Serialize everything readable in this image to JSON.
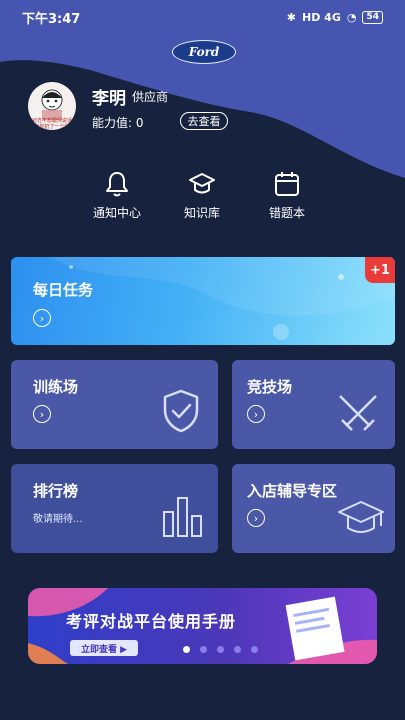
{
  "status": {
    "time": "下午3:47",
    "network": "HD 4G",
    "battery": "54"
  },
  "brand": {
    "logo_text": "Ford"
  },
  "profile": {
    "name": "李明",
    "role": "供应商",
    "ability_label": "能力值: 0",
    "view_button": "去查看",
    "avatar_lines": [
      "对方不想跟你说话",
      "向你扔了一个饼"
    ]
  },
  "quick_actions": [
    {
      "label": "通知中心",
      "icon": "bell-icon"
    },
    {
      "label": "知识库",
      "icon": "graduation-cap-icon"
    },
    {
      "label": "错题本",
      "icon": "calendar-icon"
    }
  ],
  "cards": {
    "daily": {
      "title": "每日任务",
      "badge": "+1"
    },
    "training": {
      "title": "训练场"
    },
    "arena": {
      "title": "竞技场"
    },
    "ranking": {
      "title": "排行榜",
      "subtitle": "敬请期待..."
    },
    "store": {
      "title": "入店辅导专区"
    }
  },
  "banner": {
    "title": "考评对战平台使用手册",
    "button": "立即查看 ▶",
    "dot_count": 5,
    "active_dot": 0
  },
  "colors": {
    "background": "#17223e",
    "header": "#4656b0",
    "card": "#4a58a7",
    "accent_red": "#ea3b3b"
  }
}
